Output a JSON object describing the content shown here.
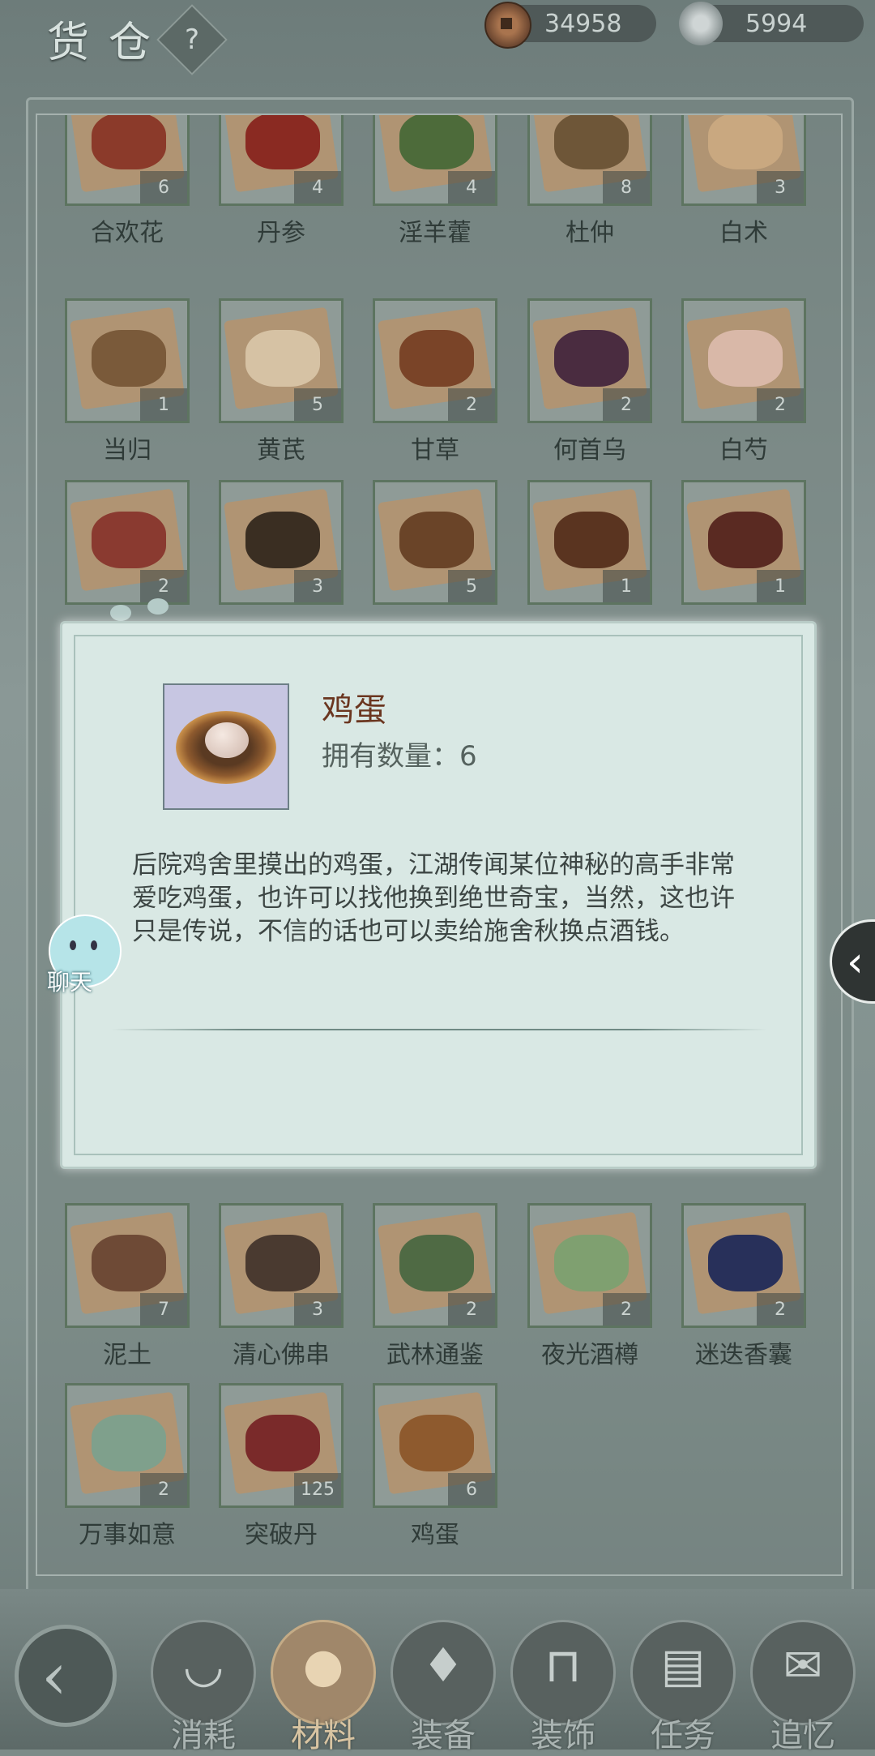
{
  "header": {
    "title": "货仓",
    "help_label": "?",
    "copper_coins": "34958",
    "silver_ingots": "5994"
  },
  "inventory": {
    "rows": [
      [
        {
          "name": "合欢花",
          "qty": "6",
          "color": "#8b3a2a"
        },
        {
          "name": "丹参",
          "qty": "4",
          "color": "#8a2a22"
        },
        {
          "name": "淫羊藿",
          "qty": "4",
          "color": "#4d6b3a"
        },
        {
          "name": "杜仲",
          "qty": "8",
          "color": "#6e5638"
        },
        {
          "name": "白术",
          "qty": "3",
          "color": "#c9a880"
        }
      ],
      [
        {
          "name": "当归",
          "qty": "1",
          "color": "#7a5a3a"
        },
        {
          "name": "黄芪",
          "qty": "5",
          "color": "#d6c2a4"
        },
        {
          "name": "甘草",
          "qty": "2",
          "color": "#7a4428"
        },
        {
          "name": "何首乌",
          "qty": "2",
          "color": "#4a2c40"
        },
        {
          "name": "白芍",
          "qty": "2",
          "color": "#d9b8a8"
        }
      ],
      [
        {
          "name": "",
          "qty": "2",
          "color": "#8a3a30"
        },
        {
          "name": "",
          "qty": "3",
          "color": "#3a2e22"
        },
        {
          "name": "",
          "qty": "5",
          "color": "#6a4428"
        },
        {
          "name": "",
          "qty": "1",
          "color": "#5a3420"
        },
        {
          "name": "",
          "qty": "1",
          "color": "#5a2a22"
        }
      ],
      [
        {
          "name": "泥土",
          "qty": "7",
          "color": "#6e4a36"
        },
        {
          "name": "清心佛串",
          "qty": "3",
          "color": "#4a3a30"
        },
        {
          "name": "武林通鉴",
          "qty": "2",
          "color": "#4f6a44"
        },
        {
          "name": "夜光酒樽",
          "qty": "2",
          "color": "#7fa070"
        },
        {
          "name": "迷迭香囊",
          "qty": "2",
          "color": "#28305a"
        }
      ],
      [
        {
          "name": "万事如意",
          "qty": "2",
          "color": "#7fa08c"
        },
        {
          "name": "突破丹",
          "qty": "125",
          "color": "#7a2a2a"
        },
        {
          "name": "鸡蛋",
          "qty": "6",
          "color": "#8e5a2e"
        }
      ]
    ]
  },
  "modal": {
    "item_name": "鸡蛋",
    "count_label": "拥有数量：6",
    "description": "后院鸡舍里摸出的鸡蛋，江湖传闻某位神秘的高手非常爱吃鸡蛋，也许可以找他换到绝世奇宝，当然，这也许只是传说，不信的话也可以卖给施舍秋换点酒钱。"
  },
  "chat": {
    "label": "聊天"
  },
  "bottom_nav": {
    "tabs": [
      {
        "label": "消耗",
        "icon": "bowl-icon"
      },
      {
        "label": "材料",
        "icon": "materials-icon"
      },
      {
        "label": "装备",
        "icon": "armor-icon"
      },
      {
        "label": "装饰",
        "icon": "decoration-icon"
      },
      {
        "label": "任务",
        "icon": "task-book-icon"
      },
      {
        "label": "追忆",
        "icon": "letter-icon"
      }
    ],
    "active_index": 1
  }
}
